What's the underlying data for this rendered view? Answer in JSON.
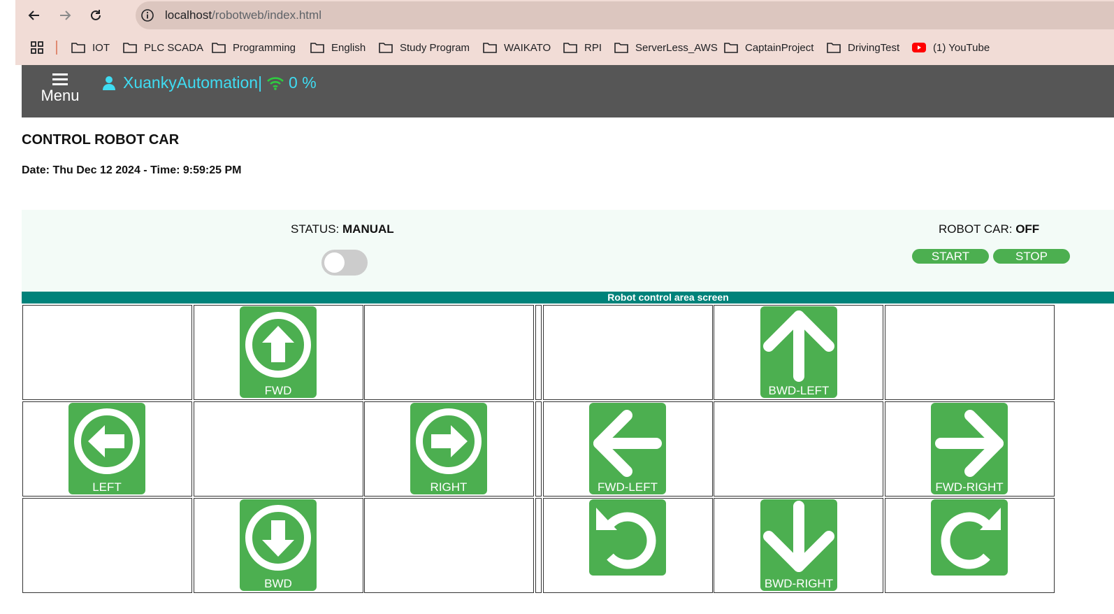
{
  "browser": {
    "url_host": "localhost",
    "url_path": "/robotweb/index.html",
    "bookmarks": [
      "IOT",
      "PLC SCADA",
      "Programming",
      "English",
      "Study Program",
      "WAIKATO",
      "RPI",
      "ServerLess_AWS",
      "CaptainProject",
      "DrivingTest",
      "(1) YouTube"
    ]
  },
  "header": {
    "menu_label": "Menu",
    "username": "XuankyAutomation|",
    "signal_percent": "0 %"
  },
  "page": {
    "title": "CONTROL ROBOT CAR",
    "datetime": "Date: Thu Dec 12 2024 - Time: 9:59:25 PM"
  },
  "status": {
    "status_label": "STATUS: ",
    "status_value": "MANUAL",
    "mode_toggle_on": false,
    "car_label": "ROBOT CAR: ",
    "car_value": "OFF",
    "start_label": "START",
    "stop_label": "STOP"
  },
  "control_area": {
    "title": "Robot control area screen",
    "buttons": {
      "fwd": "FWD",
      "left": "LEFT",
      "right": "RIGHT",
      "bwd": "BWD",
      "bwd_left": "BWD-LEFT",
      "fwd_left": "FWD-LEFT",
      "fwd_right": "FWD-RIGHT",
      "bwd_right": "BWD-RIGHT"
    },
    "icons": {
      "fwd": "circle-arrow-up-icon",
      "left": "circle-arrow-left-icon",
      "right": "circle-arrow-right-icon",
      "bwd": "circle-arrow-down-icon",
      "bwd_left": "arrow-up-icon",
      "fwd_left": "arrow-left-icon",
      "fwd_right": "arrow-right-icon",
      "bwd_right": "arrow-down-icon",
      "rotate_left": "rotate-counterclockwise-icon",
      "rotate_right": "rotate-clockwise-icon"
    }
  },
  "colors": {
    "header_bg": "#565656",
    "accent_cyan": "#3fdcf2",
    "wifi_green": "#2ecc40",
    "button_green": "#4caf50",
    "bar_teal": "#00827a",
    "panel_bg": "#f3fbf7"
  }
}
